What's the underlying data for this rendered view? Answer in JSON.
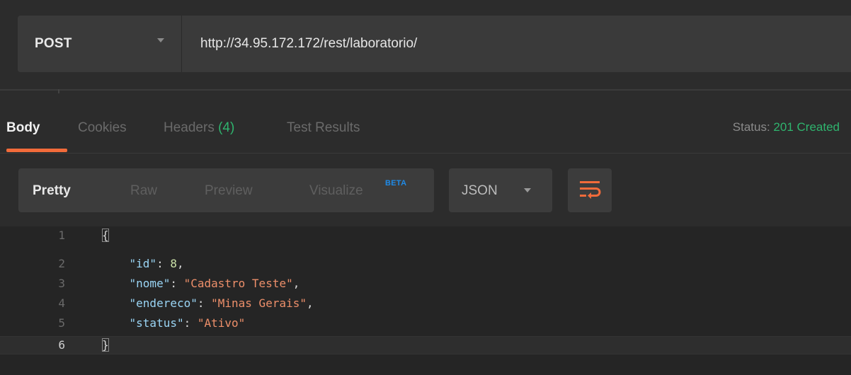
{
  "request": {
    "method": "POST",
    "url": "http://34.95.172.172/rest/laboratorio/"
  },
  "response_tabs": [
    {
      "label": "Body",
      "active": true
    },
    {
      "label": "Cookies",
      "active": false
    },
    {
      "label": "Headers",
      "count": "(4)",
      "active": false
    },
    {
      "label": "Test Results",
      "active": false
    }
  ],
  "status": {
    "label": "Status:",
    "value": "201 Created",
    "color": "#2fb46e"
  },
  "view_options": [
    {
      "label": "Pretty",
      "active": true
    },
    {
      "label": "Raw",
      "active": false
    },
    {
      "label": "Preview",
      "active": false
    },
    {
      "label": "Visualize",
      "badge": "BETA",
      "active": false
    }
  ],
  "format": {
    "selected": "JSON"
  },
  "wrap_icon": "wrap-lines-icon",
  "accent_color": "#f26b3a",
  "code_lines": [
    {
      "num": "1",
      "text": "{"
    },
    {
      "num": "2",
      "key": "\"id\"",
      "value": "8",
      "trail": ","
    },
    {
      "num": "3",
      "key": "\"nome\"",
      "value": "\"Cadastro Teste\"",
      "trail": ","
    },
    {
      "num": "4",
      "key": "\"endereco\"",
      "value": "\"Minas Gerais\"",
      "trail": ","
    },
    {
      "num": "5",
      "key": "\"status\"",
      "value": "\"Ativo\"",
      "trail": ""
    },
    {
      "num": "6",
      "text": "}"
    }
  ]
}
